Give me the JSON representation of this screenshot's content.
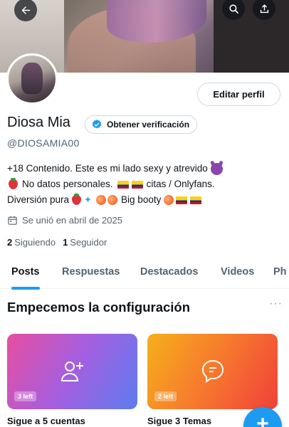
{
  "header": {
    "back_icon": "arrow-left-icon",
    "search_icon": "search-icon",
    "share_icon": "share-icon"
  },
  "profile": {
    "edit_button": "Editar perfil",
    "name": "Diosa Mia",
    "verify_label": "Obtener verificación",
    "handle": "@DIOSAMIA00",
    "bio_line1": "+18 Contenido. Este es mi lado sexy y atrevido",
    "bio_line2_a": "No datos personales.",
    "bio_line2_b": "citas / Onlyfans.",
    "bio_line3_a": "Diversión pura",
    "bio_line3_b": "Big booty",
    "joined": "Se unió en abril de 2025",
    "following_count": "2",
    "following_label": "Siguiendo",
    "followers_count": "1",
    "followers_label": "Seguidor"
  },
  "tabs": [
    {
      "label": "Posts"
    },
    {
      "label": "Respuestas"
    },
    {
      "label": "Destacados"
    },
    {
      "label": "Videos"
    },
    {
      "label": "Ph"
    }
  ],
  "setup": {
    "title": "Empecemos la configuración",
    "more": "···",
    "cards": [
      {
        "badge": "3 left",
        "label": "Sigue a 5 cuentas",
        "icon": "add-person-icon"
      },
      {
        "badge": "2 left",
        "label": "Sigue 3 Temas",
        "icon": "topic-bubble-icon"
      }
    ]
  },
  "fab": {
    "label": "+"
  },
  "colors": {
    "accent": "#1d9bf0",
    "text": "#0f1419",
    "muted": "#536471"
  }
}
